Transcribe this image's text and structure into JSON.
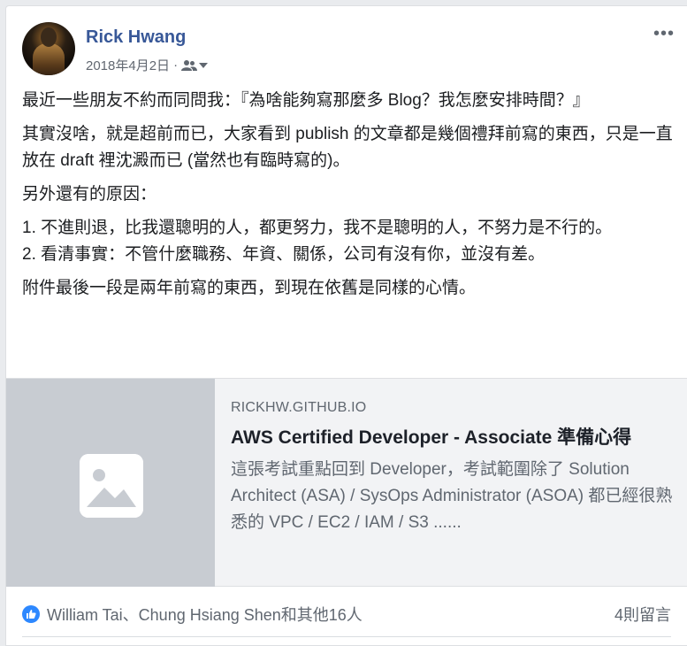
{
  "post": {
    "author": "Rick Hwang",
    "date": "2018年4月2日",
    "meta_separator": "·",
    "paragraphs": [
      "最近一些朋友不約而同問我：『為啥能夠寫那麼多 Blog？我怎麼安排時間？』",
      "其實沒啥，就是超前而已，大家看到 publish 的文章都是幾個禮拜前寫的東西，只是一直放在 draft 裡沈澱而已 (當然也有臨時寫的)。",
      "另外還有的原因：",
      "1. 不進則退，比我還聰明的人，都更努力，我不是聰明的人，不努力是不行的。",
      "2. 看清事實：不管什麼職務、年資、關係，公司有沒有你，並沒有差。",
      "附件最後一段是兩年前寫的東西，到現在依舊是同樣的心情。"
    ]
  },
  "link_preview": {
    "domain": "RICKHW.GITHUB.IO",
    "title": "AWS Certified Developer - Associate 準備心得",
    "description": "這張考試重點回到 Developer，考試範圍除了 Solution Architect (ASA) / SysOps Administrator (ASOA) 都已經很熟悉的 VPC / EC2 / IAM / S3 ......"
  },
  "footer": {
    "reactions_text": "William Tai、Chung Hsiang Shen和其他16人",
    "comments_text": "4則留言"
  },
  "icons": {
    "audience": "friends-icon",
    "more": "more-options-icon",
    "like": "like-icon",
    "image_placeholder": "image-placeholder-icon"
  },
  "colors": {
    "author_link": "#385898",
    "like_badge": "#2d88ff",
    "thumbnail_bg": "#c8ccd2"
  }
}
